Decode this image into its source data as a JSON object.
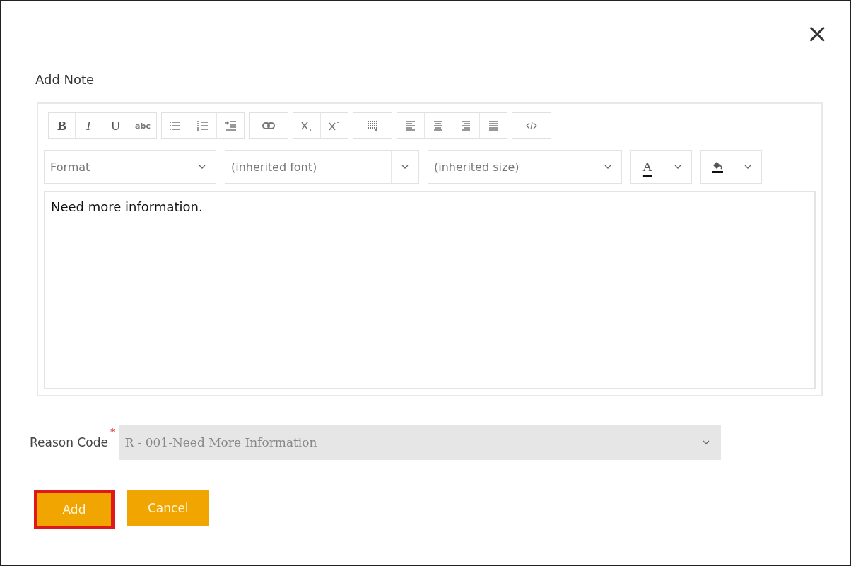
{
  "dialog": {
    "title": "Add Note",
    "close": "×"
  },
  "toolbar": {
    "groups": [
      [
        {
          "kind": "bold",
          "label": "B"
        },
        {
          "kind": "italic",
          "label": "I"
        },
        {
          "kind": "underline",
          "label": "U"
        },
        {
          "kind": "strike",
          "label": "abc"
        }
      ],
      [
        {
          "kind": "bullets"
        },
        {
          "kind": "numbers"
        },
        {
          "kind": "indent"
        }
      ],
      [
        {
          "kind": "link"
        }
      ],
      [
        {
          "kind": "subscript"
        },
        {
          "kind": "superscript"
        }
      ],
      [
        {
          "kind": "table"
        }
      ],
      [
        {
          "kind": "align-left"
        },
        {
          "kind": "align-center"
        },
        {
          "kind": "align-right"
        },
        {
          "kind": "justify"
        }
      ],
      [
        {
          "kind": "source"
        }
      ]
    ],
    "selects": [
      {
        "value": "Format"
      },
      {
        "value": "(inherited font)"
      },
      {
        "value": "(inherited size)"
      }
    ],
    "text_color": {
      "label": "A"
    }
  },
  "editor": {
    "text": "Need more information."
  },
  "reason": {
    "label": "Reason Code",
    "required_mark": "*",
    "value": "R - 001-Need More Information"
  },
  "buttons": [
    {
      "label": "Add",
      "highlighted": true
    },
    {
      "label": "Cancel",
      "highlighted": false
    }
  ]
}
